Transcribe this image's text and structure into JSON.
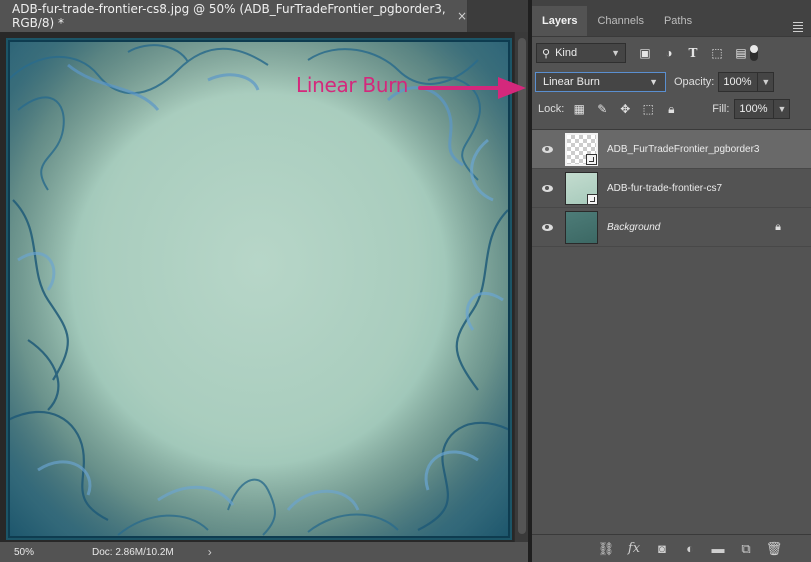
{
  "document": {
    "tab_title": "ADB-fur-trade-frontier-cs8.jpg @ 50% (ADB_FurTradeFrontier_pgborder3, RGB/8) *",
    "close_glyph": "×",
    "status": {
      "zoom": "50%",
      "doc_size": "Doc: 2.86M/10.2M",
      "arrow": "›"
    }
  },
  "panel": {
    "tabs": [
      {
        "label": "Layers",
        "active": true
      },
      {
        "label": "Channels",
        "active": false
      },
      {
        "label": "Paths",
        "active": false
      }
    ],
    "filter": {
      "kind_label": "Kind",
      "icons": [
        "image-filter-icon",
        "adjustment-filter-icon",
        "type-filter-icon",
        "shape-filter-icon",
        "smart-object-filter-icon"
      ]
    },
    "blend_mode": "Linear Burn",
    "opacity_label": "Opacity:",
    "opacity_value": "100%",
    "lock_label": "Lock:",
    "fill_label": "Fill:",
    "fill_value": "100%",
    "layers": [
      {
        "name": "ADB_FurTradeFrontier_pgborder3",
        "selected": true,
        "thumb": "transparent",
        "smart_object": true,
        "locked": false,
        "italic": false
      },
      {
        "name": "ADB-fur-trade-frontier-cs7",
        "selected": false,
        "thumb": "mint",
        "smart_object": true,
        "locked": false,
        "italic": false
      },
      {
        "name": "Background",
        "selected": false,
        "thumb": "dark",
        "smart_object": false,
        "locked": true,
        "italic": true
      }
    ],
    "footer_icons": [
      "link-layers-icon",
      "fx-icon",
      "add-mask-icon",
      "adjustment-layer-icon",
      "new-group-icon",
      "new-layer-icon",
      "delete-layer-icon"
    ]
  },
  "annotation": {
    "text": "Linear Burn",
    "color": "#d4287c"
  },
  "colors": {
    "panel_bg": "#535353",
    "selected_layer": "#696969",
    "blend_focus": "#5a8fd0"
  }
}
